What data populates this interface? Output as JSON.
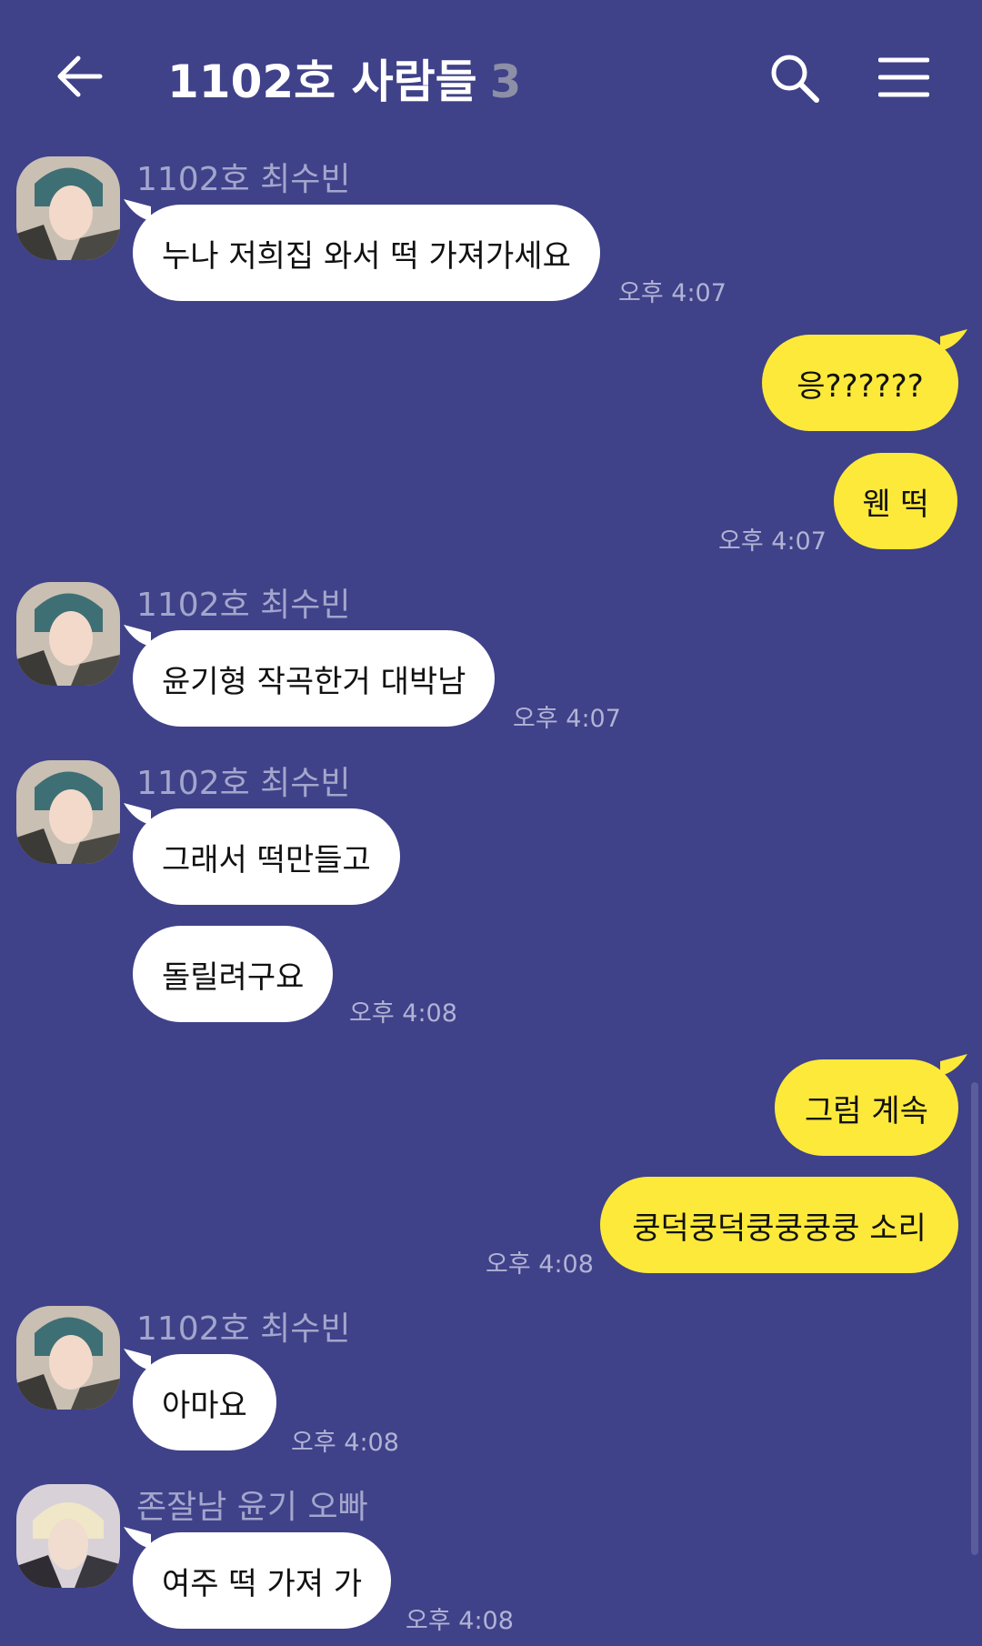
{
  "header": {
    "title": "1102호 사람들",
    "member_count": "3",
    "back_icon": "arrow-left-icon",
    "search_icon": "search-icon",
    "menu_icon": "hamburger-menu-icon"
  },
  "colors": {
    "background": "#3f4189",
    "incoming_bubble": "#ffffff",
    "outgoing_bubble": "#fde93a",
    "sender_name": "#a3a6cc",
    "timestamp": "#b0b3d4"
  },
  "messages": [
    {
      "sender": "1102호 최수빈",
      "text": "누나 저희집 와서 떡 가져가세요",
      "time": "오후 4:07"
    },
    {
      "text": "응??????"
    },
    {
      "text": "웬 떡",
      "time": "오후 4:07"
    },
    {
      "sender": "1102호 최수빈",
      "text": "윤기형 작곡한거 대박남",
      "time": "오후 4:07"
    },
    {
      "sender": "1102호 최수빈",
      "text": "그래서 떡만들고"
    },
    {
      "text": "돌릴려구요",
      "time": "오후 4:08"
    },
    {
      "text": "그럼 계속"
    },
    {
      "text": "쿵덕쿵덕쿵쿵쿵쿵 소리",
      "time": "오후 4:08"
    },
    {
      "sender": "1102호 최수빈",
      "text": "아마요",
      "time": "오후 4:08"
    },
    {
      "sender": "존잘남 윤기 오빠",
      "text": "여주 떡 가져 가",
      "time": "오후 4:08"
    }
  ]
}
